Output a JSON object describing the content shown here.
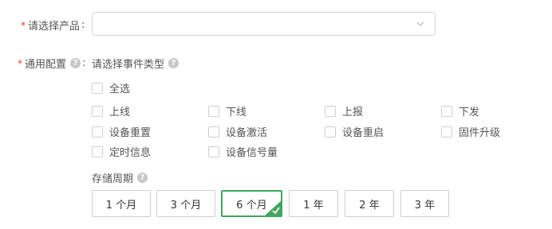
{
  "product": {
    "required_mark": "*",
    "label": "请选择产品",
    "colon": ":",
    "value": ""
  },
  "common_config": {
    "required_mark": "*",
    "label": "通用配置",
    "colon": ":",
    "hint": "请选择事件类型",
    "select_all": "全选",
    "events": [
      "上线",
      "下线",
      "上报",
      "下发",
      "设备重置",
      "设备激活",
      "设备重启",
      "固件升级",
      "定时信息",
      "设备信号量"
    ]
  },
  "storage": {
    "label": "存储周期",
    "options": [
      "1 个月",
      "3 个月",
      "6 个月",
      "1 年",
      "2 年",
      "3 年"
    ],
    "selected": "6 个月"
  },
  "colors": {
    "required": "#e53935",
    "selected_border": "#3fa660"
  }
}
